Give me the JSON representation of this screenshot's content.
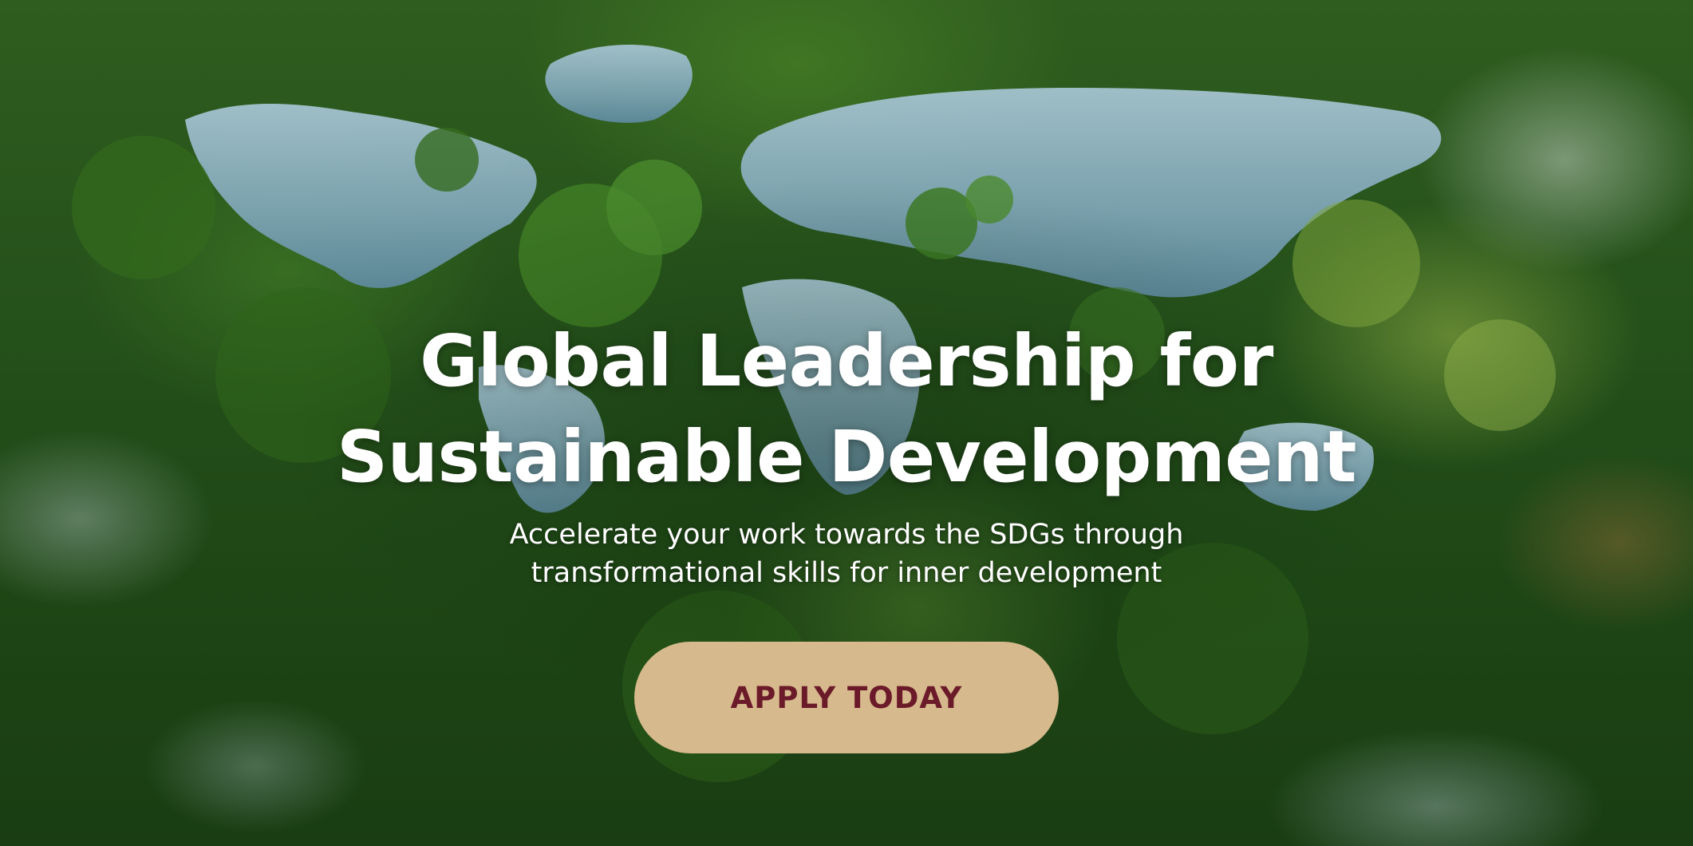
{
  "hero": {
    "title_line1": "Global Leadership for",
    "title_line2": "Sustainable Development",
    "subtitle_line1": "Accelerate your work towards the SDGs through",
    "subtitle_line2": "transformational skills for inner development",
    "cta_label": "APPLY TODAY",
    "background_description_icon": "world-map-lakes-in-forest"
  },
  "colors": {
    "cta_background": "#d6b98c",
    "cta_text": "#6b1a2a",
    "title_text": "#ffffff",
    "forest": "#24501a",
    "water": "#8fb3c4"
  }
}
